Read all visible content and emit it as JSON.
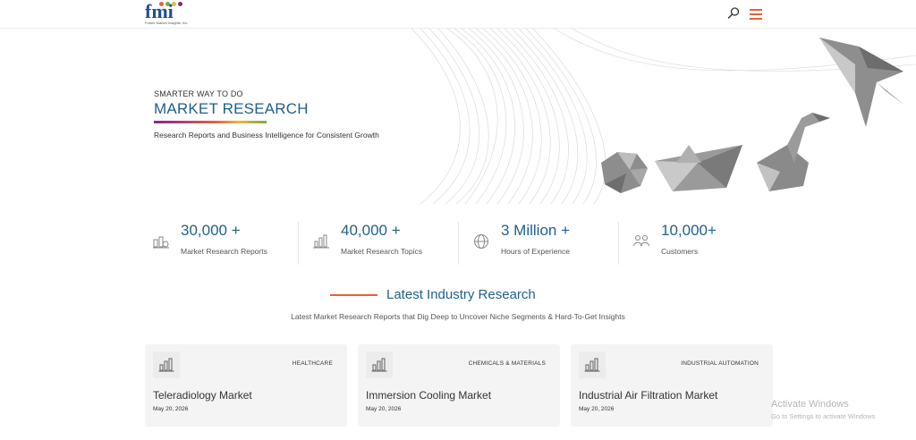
{
  "header": {
    "logo_text": "fmi",
    "logo_tagline": "Future Market Insights, Inc.",
    "search_icon": "search-icon",
    "menu_icon": "hamburger-menu-icon",
    "accent_color": "#e0643c",
    "brand_color": "#1f4e99"
  },
  "hero": {
    "kicker": "SMARTER WAY TO DO",
    "title": "MARKET RESEARCH",
    "subtitle": "Research Reports and Business Intelligence for Consistent Growth",
    "title_color": "#1f5f8b"
  },
  "stats": [
    {
      "value": "30,000 +",
      "label": "Market Research Reports",
      "icon": "reports-chart-icon"
    },
    {
      "value": "40,000 +",
      "label": "Market Research Topics",
      "icon": "bar-chart-icon"
    },
    {
      "value": "3 Million +",
      "label": "Hours of Experience",
      "icon": "globe-icon"
    },
    {
      "value": "10,000+",
      "label": "Customers",
      "icon": "customers-icon"
    }
  ],
  "latest": {
    "title": "Latest Industry Research",
    "subtitle": "Latest Market Research Reports that Dig Deep to Uncover Niche Segments & Hard-To-Get Insights"
  },
  "cards": [
    {
      "category": "HEALTHCARE",
      "title": "Teleradiology Market",
      "date": "May 20, 2026",
      "icon": "bar-chart-icon"
    },
    {
      "category": "CHEMICALS & MATERIALS",
      "title": "Immersion Cooling Market",
      "date": "May 20, 2026",
      "icon": "bar-chart-icon"
    },
    {
      "category": "INDUSTRIAL AUTOMATION",
      "title": "Industrial Air Filtration Market",
      "date": "May 20, 2026",
      "icon": "bar-chart-icon"
    }
  ],
  "watermark": {
    "title": "Activate Windows",
    "subtitle": "Go to Settings to activate Windows"
  }
}
